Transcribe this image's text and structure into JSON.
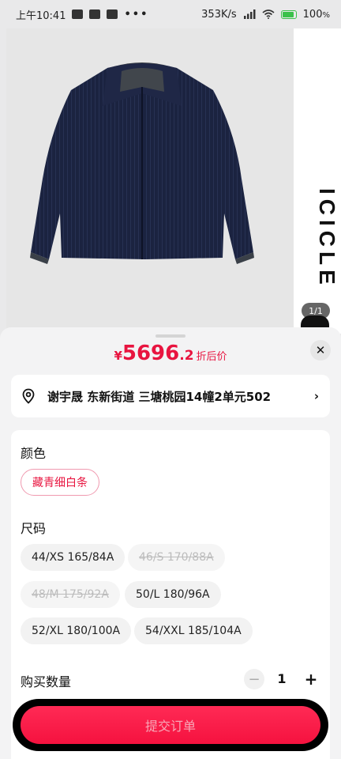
{
  "status_bar": {
    "time": "上午10:41",
    "network_speed": "353K/s",
    "battery": "100",
    "battery_unit": "%",
    "more": "•••"
  },
  "product": {
    "brand_vertical": "ICICLE",
    "page_indicator": "1/1"
  },
  "sheet": {
    "price": {
      "currency": "¥",
      "integer": "5696",
      "decimal": ".2",
      "label": "折后价"
    },
    "close_icon": "✕",
    "address": {
      "text": "谢宇晟 东新街道 三塘桃园14幢2单元502",
      "arrow": "›"
    },
    "color": {
      "title": "颜色",
      "options": [
        "藏青细白条"
      ],
      "selected": "藏青细白条"
    },
    "size": {
      "title": "尺码",
      "options": [
        {
          "label": "44/XS 165/84A",
          "available": true
        },
        {
          "label": "46/S 170/88A",
          "available": false
        },
        {
          "label": "48/M 175/92A",
          "available": false
        },
        {
          "label": "50/L 180/96A",
          "available": true
        },
        {
          "label": "52/XL 180/100A",
          "available": true
        },
        {
          "label": "54/XXL 185/104A",
          "available": true
        }
      ]
    },
    "quantity": {
      "label": "购买数量",
      "value": "1",
      "minus": "−",
      "plus": "+"
    },
    "submit_label": "提交订单"
  },
  "colors": {
    "accent": "#e8143f",
    "button": "#f5123f",
    "jacket": "#1b2340"
  }
}
